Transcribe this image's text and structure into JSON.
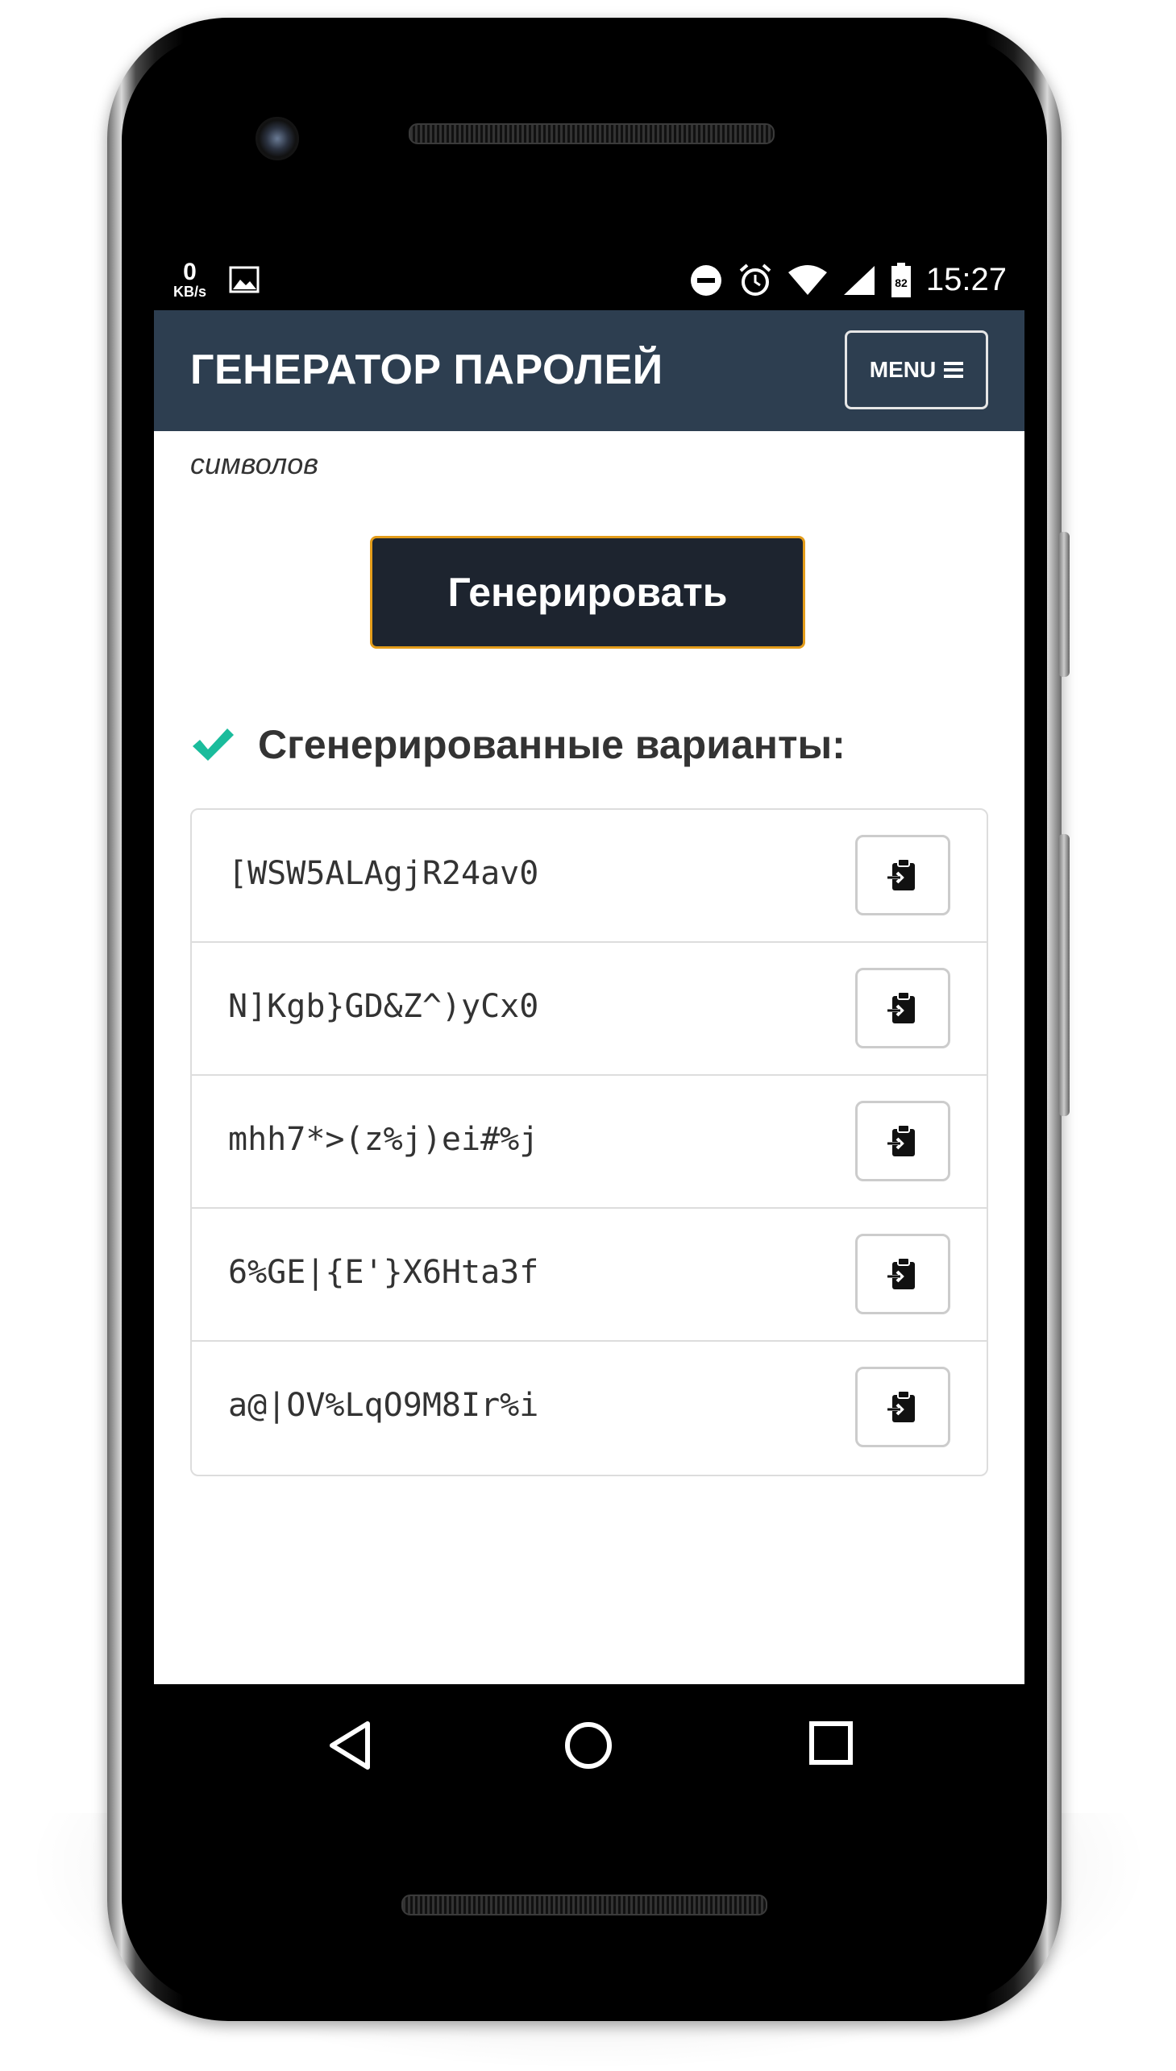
{
  "status_bar": {
    "net_speed_value": "0",
    "net_speed_unit": "KB/s",
    "battery_level": "82",
    "time": "15:27"
  },
  "app_bar": {
    "title": "ГЕНЕРАТОР ПАРОЛЕЙ",
    "menu_label": "MENU"
  },
  "content": {
    "subtext": "символов",
    "generate_button": "Генерировать",
    "results_title": "Сгенерированные варианты:",
    "passwords": [
      "[WSW5ALAgjR24av0",
      "N]Kgb}GD&Z^)yCx0",
      "mhh7*>(z%j)ei#%j",
      "6%GE|{E'}X6Hta3f",
      "a@|OV%LqO9M8Ir%i"
    ]
  },
  "colors": {
    "app_bar_bg": "#2d3e50",
    "button_bg": "#1d242f",
    "button_border": "#e39c1a",
    "check": "#1abc9c"
  }
}
